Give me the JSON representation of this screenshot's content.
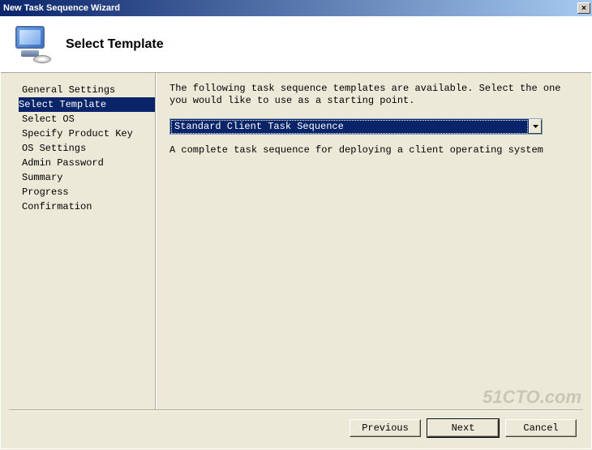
{
  "window": {
    "title": "New Task Sequence Wizard",
    "close_symbol": "×"
  },
  "header": {
    "title": "Select Template"
  },
  "sidebar": {
    "items": [
      {
        "label": "General Settings"
      },
      {
        "label": "Select Template"
      },
      {
        "label": "Select OS"
      },
      {
        "label": "Specify Product Key"
      },
      {
        "label": "OS Settings"
      },
      {
        "label": "Admin Password"
      },
      {
        "label": "Summary"
      },
      {
        "label": "Progress"
      },
      {
        "label": "Confirmation"
      }
    ],
    "selected_index": 1
  },
  "main": {
    "instruction": "The following task sequence templates are available.  Select the one you would like to use as a starting point.",
    "dropdown_value": "Standard Client Task Sequence",
    "description": "A complete task sequence for deploying a client operating system"
  },
  "buttons": {
    "previous": "Previous",
    "next": "Next",
    "cancel": "Cancel"
  },
  "watermark": "51CTO.com"
}
